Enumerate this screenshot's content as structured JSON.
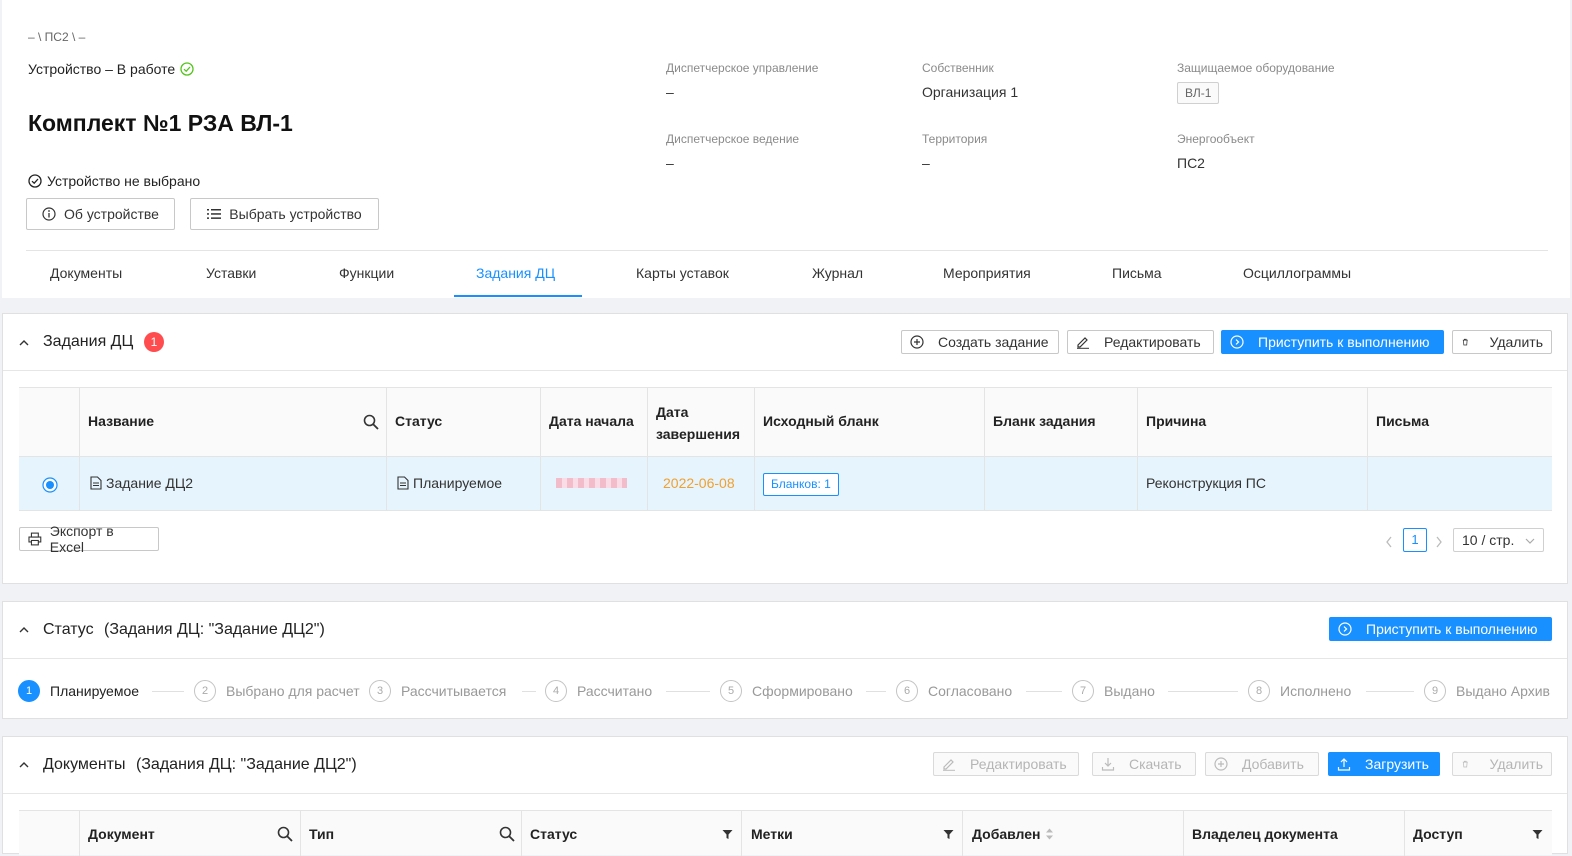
{
  "header": {
    "breadcrumb": "– \\ ПС2 \\ –",
    "device_status": "Устройство – В работе",
    "title": "Комплект №1 РЗА ВЛ-1",
    "not_selected": "Устройство не выбрано",
    "about_button": "Об устройстве",
    "select_button": "Выбрать устройство",
    "meta": {
      "dispatch_control_label": "Диспетчерское управление",
      "dispatch_control_value": "–",
      "owner_label": "Собственник",
      "owner_value": "Организация 1",
      "protected_label": "Защищаемое оборудование",
      "protected_value": "ВЛ-1",
      "dispatch_lead_label": "Диспетчерское ведение",
      "dispatch_lead_value": "–",
      "territory_label": "Территория",
      "territory_value": "–",
      "energy_label": "Энергообъект",
      "energy_value": "ПС2"
    },
    "tabs": [
      "Документы",
      "Уставки",
      "Функции",
      "Задания ДЦ",
      "Карты уставок",
      "Журнал",
      "Мероприятия",
      "Письма",
      "Осциллограммы"
    ],
    "active_tab": "Задания ДЦ"
  },
  "tasks_panel": {
    "title": "Задания ДЦ",
    "badge": "1",
    "actions": {
      "create": "Создать задание",
      "edit": "Редактировать",
      "start": "Приступить к выполнению",
      "delete": "Удалить"
    },
    "columns": {
      "name": "Название",
      "status": "Статус",
      "start_date": "Дата начала",
      "end_date": "Дата завершения",
      "source_form": "Исходный бланк",
      "task_form": "Бланк задания",
      "reason": "Причина",
      "letters": "Письма"
    },
    "row": {
      "name": "Задание ДЦ2",
      "status": "Планируемое",
      "end_date": "2022-06-08",
      "source_form": "Бланков: 1",
      "reason": "Реконструкция ПС"
    },
    "export": "Экспорт в Excel",
    "page": "1",
    "page_size": "10 / стр."
  },
  "status_panel": {
    "title": "Статус",
    "subtitle": "(Задания ДЦ: \"Задание ДЦ2\")",
    "start": "Приступить к выполнению",
    "steps": [
      "Планируемое",
      "Выбрано для расчет",
      "Рассчитывается",
      "Рассчитано",
      "Сформировано",
      "Согласовано",
      "Выдано",
      "Исполнено",
      "Выдано Архив"
    ],
    "step_numbers": [
      "1",
      "2",
      "3",
      "4",
      "5",
      "6",
      "7",
      "8",
      "9"
    ]
  },
  "docs_panel": {
    "title": "Документы",
    "subtitle": "(Задания ДЦ: \"Задание ДЦ2\")",
    "actions": {
      "edit": "Редактировать",
      "download": "Скачать",
      "add": "Добавить",
      "upload": "Загрузить",
      "delete": "Удалить"
    },
    "columns": {
      "document": "Документ",
      "type": "Тип",
      "status": "Статус",
      "tags": "Метки",
      "added": "Добавлен",
      "owner": "Владелец документа",
      "access": "Доступ"
    }
  },
  "colors": {
    "accent": "#1890ff",
    "badge": "#ff4d4f",
    "date": "#f0a030",
    "ok": "#52c41a",
    "selected_row": "#e6f4fd"
  }
}
